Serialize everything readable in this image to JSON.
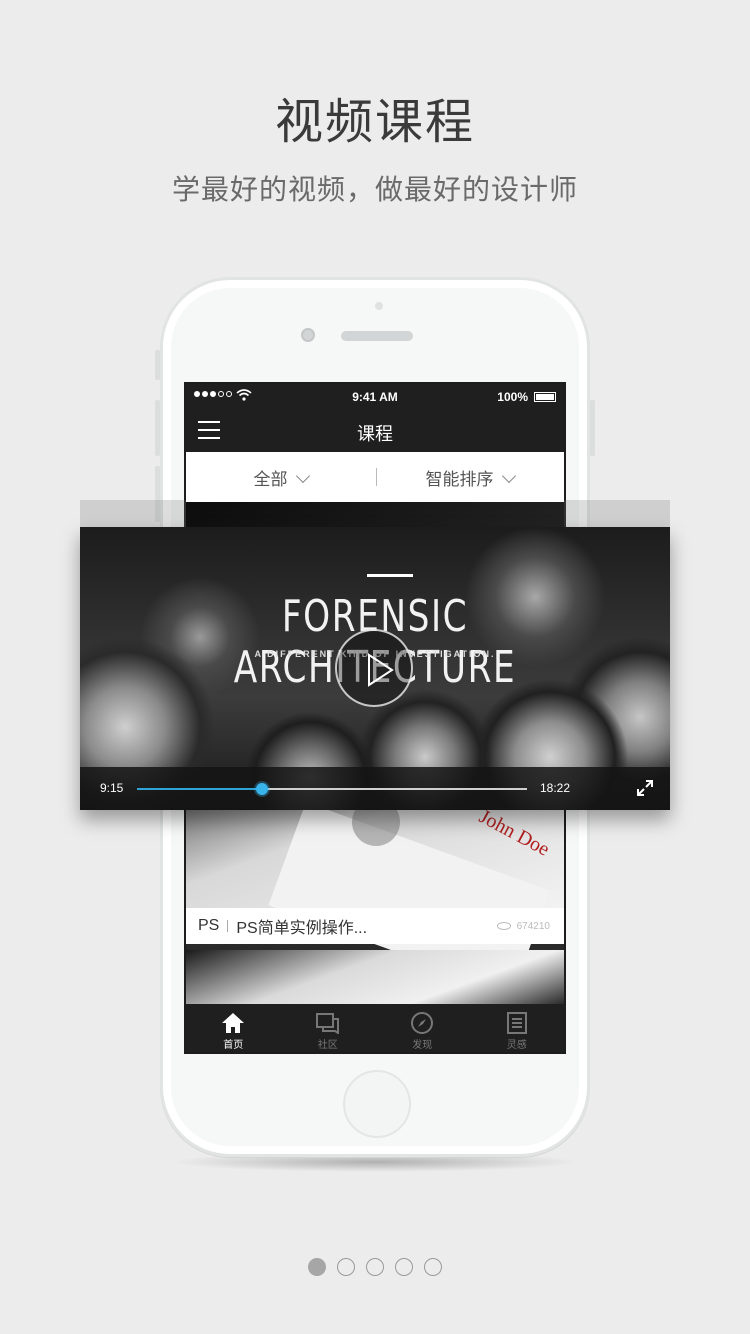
{
  "promo": {
    "headline": "视频课程",
    "subline": "学最好的视频，做最好的设计师"
  },
  "statusbar": {
    "time": "9:41 AM",
    "battery": "100%"
  },
  "navbar": {
    "title": "课程",
    "menu_icon": "hamburger-menu-icon"
  },
  "filters": [
    {
      "label": "全部"
    },
    {
      "label": "智能排序"
    }
  ],
  "video": {
    "title": "FORENSIC ARCHITECTURE",
    "subtitle": "A DIFFERENT KIND OF INVESTIGATION.",
    "current_time": "9:15",
    "total_time": "18:22",
    "progress": 0.32
  },
  "course_card": {
    "tag": "PS",
    "title": "PS简单实例操作...",
    "views": "674210",
    "artwork_text": "John Doe"
  },
  "tabbar": [
    {
      "label": "首页",
      "icon": "home-icon",
      "active": true
    },
    {
      "label": "社区",
      "icon": "chat-icon",
      "active": false
    },
    {
      "label": "发现",
      "icon": "compass-icon",
      "active": false
    },
    {
      "label": "灵感",
      "icon": "notebook-icon",
      "active": false
    }
  ],
  "pager": {
    "total": 5,
    "active_index": 0
  },
  "colors": {
    "background": "#ececec",
    "accent": "#2ea3d8",
    "dark_bar": "#1f1f1f"
  }
}
